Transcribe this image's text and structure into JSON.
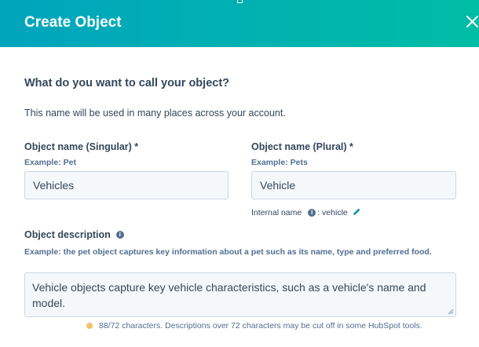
{
  "modal": {
    "title": "Create Object"
  },
  "intro": {
    "heading": "What do you want to call your object?",
    "helper": "This name will be used in many places across your account."
  },
  "singular": {
    "label": "Object name (Singular) *",
    "example": "Example: Pet",
    "value": "Vehicles"
  },
  "plural": {
    "label": "Object name (Plural) *",
    "example": "Example: Pets",
    "value": "Vehicle",
    "internal_label": "Internal name",
    "internal_value": ": vehicle"
  },
  "description": {
    "label": "Object description",
    "example": "Example: the pet object captures key information about a pet such as its name, type and preferred food.",
    "value": "Vehicle objects capture key vehicle characteristics, such as a vehicle's name and model.",
    "counter": "88/72 characters. Descriptions over 72 characters may be cut off in some HubSpot tools."
  },
  "colors": {
    "header_start": "#00a4bd",
    "header_end": "#00bda5",
    "warning": "#f5c26b",
    "link": "#0091ae"
  },
  "icons": {
    "close": "close-icon",
    "info": "info-icon",
    "edit": "pencil-icon",
    "warning": "warning-dot-icon"
  }
}
